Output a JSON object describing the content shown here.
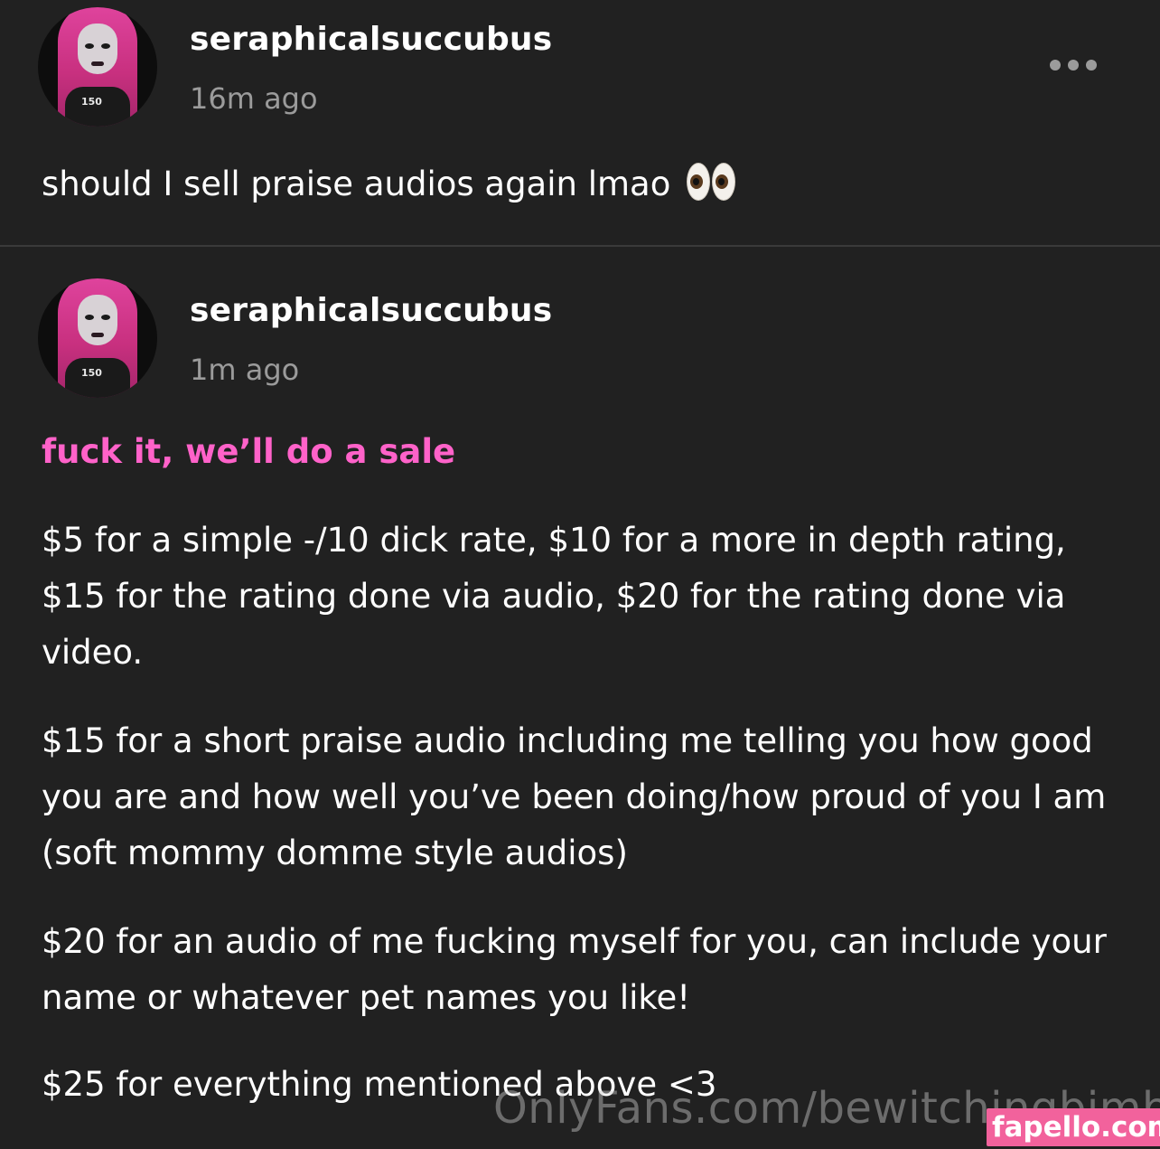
{
  "posts": [
    {
      "username": "seraphicalsuccubus",
      "timestamp": "16m ago",
      "text": "should I sell praise audios again lmao",
      "emoji": "eyes-emoji"
    },
    {
      "username": "seraphicalsuccubus",
      "timestamp": "1m ago",
      "heading": "fuck it, we’ll do a sale",
      "paragraphs": [
        "$5 for a simple -/10 dick rate, $10 for a more in depth rating, $15 for the rating done via audio, $20 for the rating done via video.",
        "$15 for a short praise audio including me telling you how good you are and how well you’ve been doing/how proud of you I am (soft mommy domme style audios)",
        "$20 for an audio of me fucking myself for you, can include your name or whatever pet names you like!",
        "$25 for everything mentioned above <3"
      ]
    }
  ],
  "avatar_shirt_text": "150",
  "more_menu_icon": "more-horizontal-icon",
  "watermark": {
    "url": "OnlyFans.com/bewitchingbimbo",
    "badge": "fapello.com"
  },
  "colors": {
    "background": "#212121",
    "text": "#ffffff",
    "muted": "#9b9b9b",
    "accent": "#ff62c9",
    "badge": "#f2629c"
  }
}
